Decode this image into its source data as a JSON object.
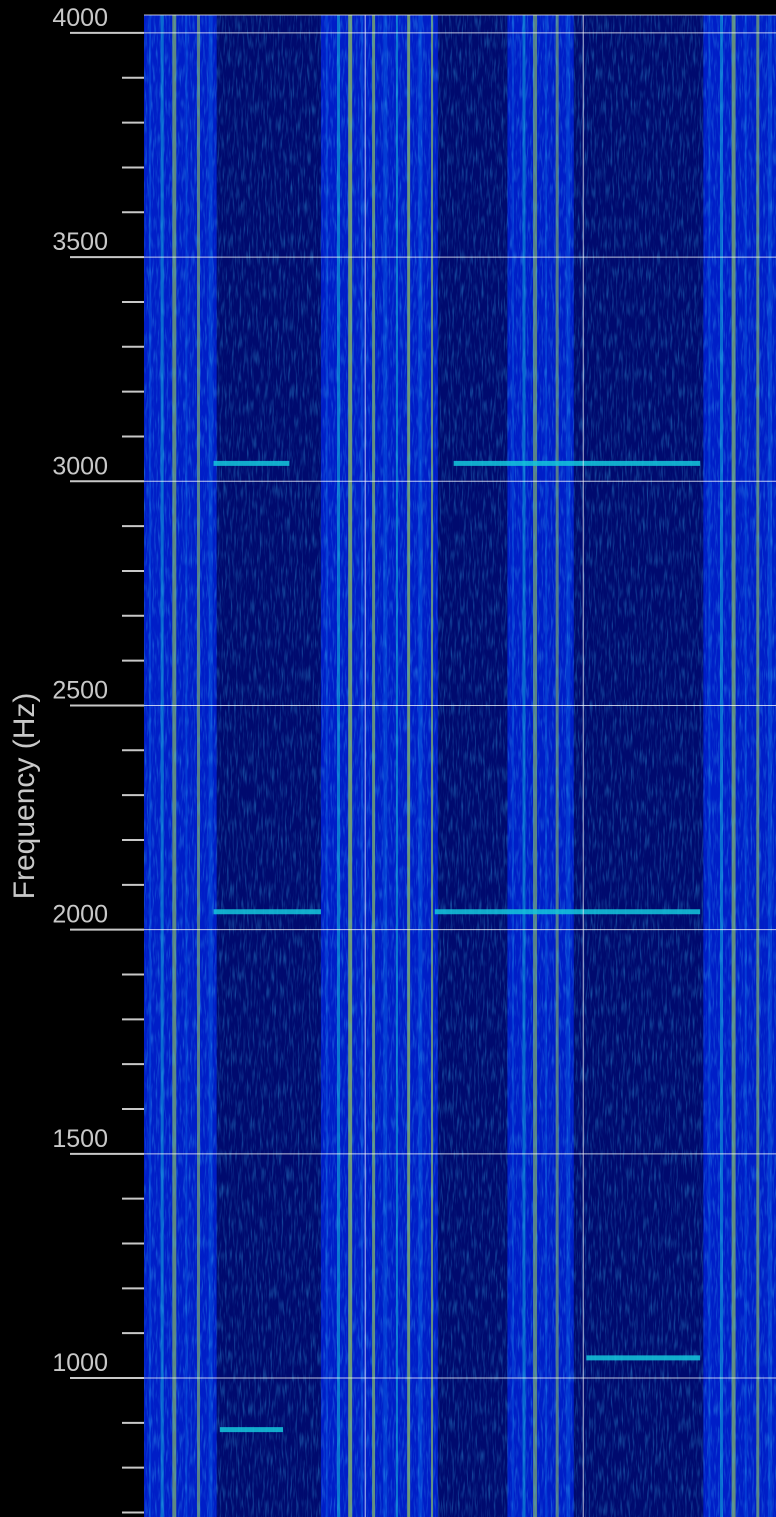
{
  "chart_data": {
    "type": "heatmap",
    "title": "",
    "xlabel": "",
    "ylabel": "Frequency (Hz)",
    "ylim": [
      690,
      4040
    ],
    "y_major_ticks": [
      1000,
      1500,
      2000,
      2500,
      3000,
      3500,
      4000
    ],
    "y_minor_step": 100,
    "grid": true,
    "colormap": [
      "#000a6e",
      "#0020d0",
      "#0a64e6",
      "#14c8dc",
      "#b4e646"
    ],
    "tones": [
      {
        "frequency": 3040,
        "segments": [
          [
            0.11,
            0.23
          ],
          [
            0.49,
            0.88
          ]
        ]
      },
      {
        "frequency": 2040,
        "segments": [
          [
            0.11,
            0.28
          ],
          [
            0.46,
            0.88
          ]
        ]
      },
      {
        "frequency": 1045,
        "segments": [
          [
            0.7,
            0.88
          ]
        ]
      },
      {
        "frequency": 885,
        "segments": [
          [
            0.12,
            0.22
          ]
        ]
      }
    ],
    "pulses": [
      {
        "start": 0.0,
        "end": 0.115,
        "level": 0.5
      },
      {
        "start": 0.28,
        "end": 0.465,
        "level": 0.65
      },
      {
        "start": 0.575,
        "end": 0.68,
        "level": 0.45
      },
      {
        "start": 0.885,
        "end": 1.0,
        "level": 0.55
      }
    ]
  }
}
